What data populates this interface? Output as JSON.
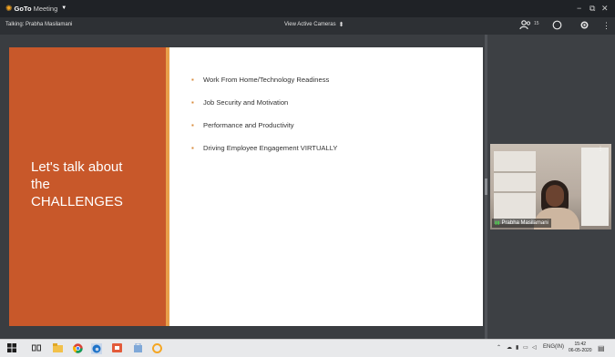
{
  "app": {
    "brand_goto": "GoTo",
    "brand_meeting": "Meeting"
  },
  "window_controls": {
    "minimize": "−",
    "restore": "⧉",
    "close": "✕"
  },
  "toolbar": {
    "talking_label": "Talking: Prabha Masilamani",
    "view_cameras_label": "View Active Cameras",
    "attendee_count": "15"
  },
  "slide": {
    "heading_line1": "Let's talk about",
    "heading_line2": "the",
    "heading_line3": "CHALLENGES",
    "bullets": [
      "Work From Home/Technology Readiness",
      "Job Security and Motivation",
      "Performance and Productivity",
      "Driving Employee Engagement VIRTUALLY"
    ]
  },
  "video": {
    "name": "Prabha Masilamani"
  },
  "taskbar": {
    "tray_lang": "ENG",
    "tray_region": "(IN)",
    "time": "15:42",
    "date": "06-05-2020"
  },
  "colors": {
    "slide_orange": "#c8582a",
    "slide_accent": "#e8a04a",
    "titlebar": "#1f2226",
    "toolbar": "#2d3034"
  },
  "icons": [
    "gear-logo-icon",
    "caret-down-icon",
    "minimize-icon",
    "restore-icon",
    "close-icon",
    "attendees-icon",
    "chat-icon",
    "settings-icon",
    "more-icon",
    "windows-start-icon",
    "task-view-icon",
    "file-explorer-icon",
    "chrome-icon",
    "edge-icon",
    "office-icon",
    "store-icon",
    "gotomeeting-taskbar-icon"
  ]
}
